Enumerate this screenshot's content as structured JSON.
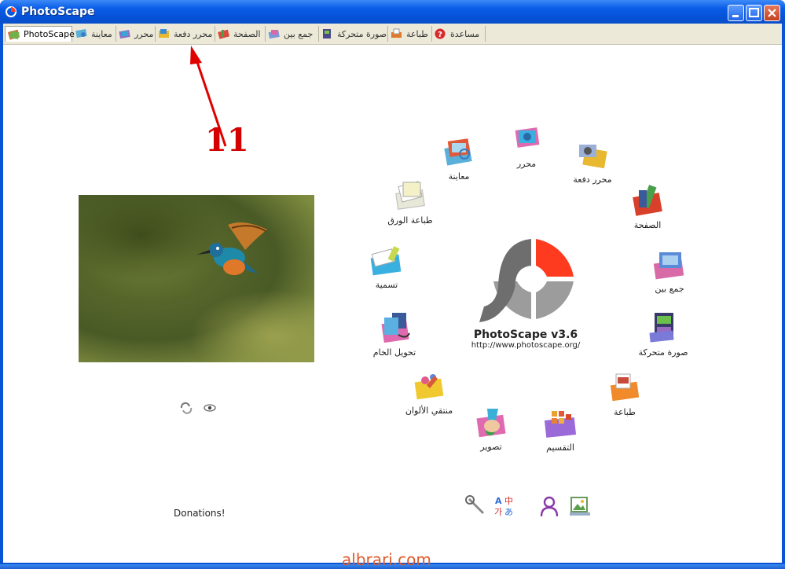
{
  "window": {
    "title": "PhotoScape"
  },
  "tabs": [
    {
      "label": "PhotoScape",
      "icon": "photoscape-tab-icon",
      "active": true
    },
    {
      "label": "معاينة",
      "icon": "viewer-tab-icon"
    },
    {
      "label": "محرر",
      "icon": "editor-tab-icon"
    },
    {
      "label": "محرر دفعة",
      "icon": "batch-editor-tab-icon"
    },
    {
      "label": "الصفحة",
      "icon": "page-tab-icon"
    },
    {
      "label": "جمع بين",
      "icon": "combine-tab-icon"
    },
    {
      "label": "صورة متحركة",
      "icon": "animated-gif-tab-icon"
    },
    {
      "label": "طباعة",
      "icon": "print-tab-icon"
    },
    {
      "label": "مساعدة",
      "icon": "help-tab-icon"
    }
  ],
  "wheel": [
    {
      "label": "محرر",
      "icon": "editor-icon"
    },
    {
      "label": "محرر دفعة",
      "icon": "batch-editor-icon"
    },
    {
      "label": "الصفحة",
      "icon": "page-icon"
    },
    {
      "label": "جمع بين",
      "icon": "combine-icon"
    },
    {
      "label": "صورة متحركة",
      "icon": "animated-gif-icon"
    },
    {
      "label": "طباعة",
      "icon": "print-icon"
    },
    {
      "label": "التقسيم",
      "icon": "splitter-icon"
    },
    {
      "label": "تصوير",
      "icon": "screen-capture-icon"
    },
    {
      "label": "منتقي الألوان",
      "icon": "color-picker-icon"
    },
    {
      "label": "تحويل الخام",
      "icon": "raw-converter-icon"
    },
    {
      "label": "تسمية",
      "icon": "rename-icon"
    },
    {
      "label": "طباعة الورق",
      "icon": "paper-print-icon"
    },
    {
      "label": "معاينة",
      "icon": "viewer-icon"
    }
  ],
  "logo": {
    "title": "PhotoScape v3.6",
    "url": "http://www.photoscape.org/"
  },
  "donations": "Donations!",
  "annotation": {
    "number": "11",
    "color": "#d40000"
  },
  "watermark": "albrari.com",
  "colors": {
    "accent": "#ff3b1f",
    "titlebar": "#0a54d6"
  }
}
